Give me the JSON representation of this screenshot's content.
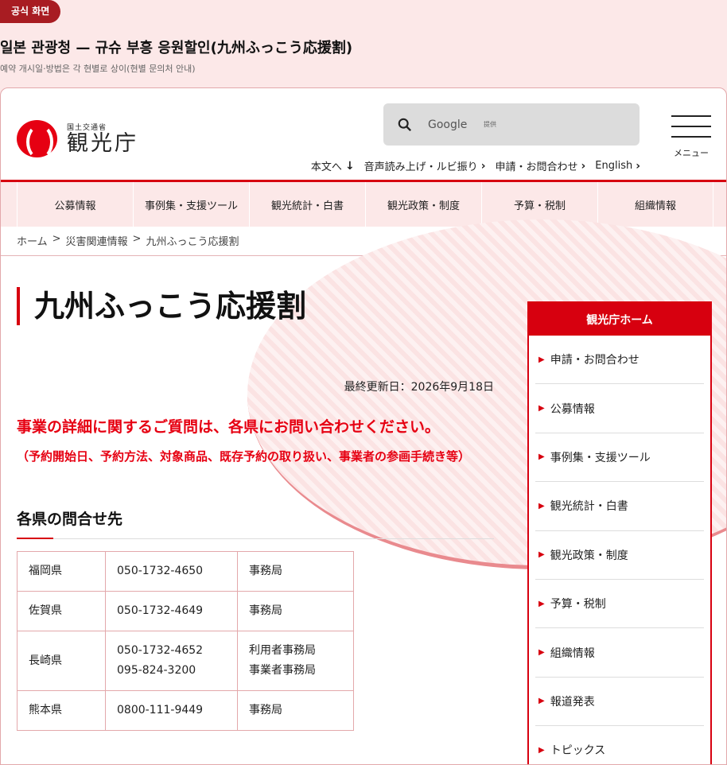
{
  "badge": "공식 화면",
  "heading": "일본 관광청 — 규슈 부흥 응원할인(九州ふっこう応援割)",
  "subheading": "예약 개시일·방법은 각 현별로 상이(현별 문의처 안내)",
  "site": {
    "logo_small": "国土交通省",
    "logo_big": "観光庁",
    "search_text": "Google",
    "search_powered": "提供",
    "menu_label": "メニュー",
    "utility": [
      {
        "label": "本文へ",
        "arrow": "↓"
      },
      {
        "label": "音声読み上げ・ルビ振り",
        "arrow": "›"
      },
      {
        "label": "申請・お問合わせ",
        "arrow": "›"
      },
      {
        "label": "English",
        "arrow": "›"
      }
    ],
    "nav": [
      "公募情報",
      "事例集・支援ツール",
      "観光統計・白書",
      "観光政策・制度",
      "予算・税制",
      "組織情報"
    ],
    "breadcrumb": [
      "ホーム",
      "災害関連情報",
      "九州ふっこう応援割"
    ],
    "breadcrumb_sep": ">"
  },
  "main": {
    "title": "九州ふっこう応援割",
    "updated": "最終更新日：2026年9月18日",
    "notice": "事業の詳細に関するご質問は、各県にお問い合わせください。",
    "notice_sub": "（予約開始日、予約方法、対象商品、既存予約の取り扱い、事業者の参画手続き等）",
    "section_title": "各県の問合せ先",
    "contacts": [
      {
        "pref": "福岡県",
        "phone1": "050-1732-4650",
        "phone2": "",
        "office1": "事務局",
        "office2": ""
      },
      {
        "pref": "佐賀県",
        "phone1": "050-1732-4649",
        "phone2": "",
        "office1": "事務局",
        "office2": ""
      },
      {
        "pref": "長崎県",
        "phone1": "050-1732-4652",
        "phone2": "095-824-3200",
        "office1": "利用者事務局",
        "office2": "事業者事務局"
      },
      {
        "pref": "熊本県",
        "phone1": "0800-111-9449",
        "phone2": "",
        "office1": "事務局",
        "office2": ""
      }
    ]
  },
  "sidebar": {
    "head": "観光庁ホーム",
    "items": [
      "申請・お問合わせ",
      "公募情報",
      "事例集・支援ツール",
      "観光統計・白書",
      "観光政策・制度",
      "予算・税制",
      "組織情報",
      "報道発表",
      "トピックス"
    ]
  },
  "colors": {
    "accent": "#d7000f",
    "notice": "#e60012",
    "badge": "#a81c22",
    "background": "#fce8e8"
  }
}
